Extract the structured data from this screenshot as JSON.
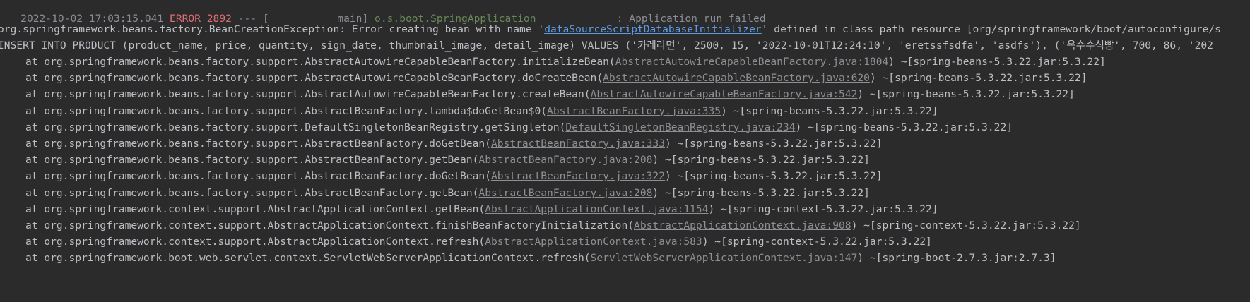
{
  "console": {
    "top_line": {
      "timestamp": "2022-10-02 17:03:15.041",
      "level": "ERROR 2892",
      "separator": "---",
      "thread": "[           main]",
      "logger": "o.s.boot.SpringApplication",
      "message": ": Application run failed"
    },
    "exception": {
      "prefix": "org.springframework.beans.factory.BeanCreationException: Error creating bean with name '",
      "bean_link": "dataSourceScriptDatabaseInitializer",
      "suffix": "' defined in class path resource [org/springframework/boot/autoconfigure/s"
    },
    "sql_line": "INSERT INTO PRODUCT (product_name, price, quantity, sign_date, thumbnail_image, detail_image) VALUES ('카레라면', 2500, 15, '2022-10-01T12:24:10', 'eretssfsdfa', 'asdfs'), ('옥수수식빵', 700, 86, '202",
    "stack": [
      {
        "method": "at org.springframework.beans.factory.support.AbstractAutowireCapableBeanFactory.initializeBean(",
        "source": "AbstractAutowireCapableBeanFactory.java:1804",
        "jar": ") ~[spring-beans-5.3.22.jar:5.3.22]"
      },
      {
        "method": "at org.springframework.beans.factory.support.AbstractAutowireCapableBeanFactory.doCreateBean(",
        "source": "AbstractAutowireCapableBeanFactory.java:620",
        "jar": ") ~[spring-beans-5.3.22.jar:5.3.22]"
      },
      {
        "method": "at org.springframework.beans.factory.support.AbstractAutowireCapableBeanFactory.createBean(",
        "source": "AbstractAutowireCapableBeanFactory.java:542",
        "jar": ") ~[spring-beans-5.3.22.jar:5.3.22]"
      },
      {
        "method": "at org.springframework.beans.factory.support.AbstractBeanFactory.lambda$doGetBean$0(",
        "source": "AbstractBeanFactory.java:335",
        "jar": ") ~[spring-beans-5.3.22.jar:5.3.22]"
      },
      {
        "method": "at org.springframework.beans.factory.support.DefaultSingletonBeanRegistry.getSingleton(",
        "source": "DefaultSingletonBeanRegistry.java:234",
        "jar": ") ~[spring-beans-5.3.22.jar:5.3.22]"
      },
      {
        "method": "at org.springframework.beans.factory.support.AbstractBeanFactory.doGetBean(",
        "source": "AbstractBeanFactory.java:333",
        "jar": ") ~[spring-beans-5.3.22.jar:5.3.22]"
      },
      {
        "method": "at org.springframework.beans.factory.support.AbstractBeanFactory.getBean(",
        "source": "AbstractBeanFactory.java:208",
        "jar": ") ~[spring-beans-5.3.22.jar:5.3.22]"
      },
      {
        "method": "at org.springframework.beans.factory.support.AbstractBeanFactory.doGetBean(",
        "source": "AbstractBeanFactory.java:322",
        "jar": ") ~[spring-beans-5.3.22.jar:5.3.22]"
      },
      {
        "method": "at org.springframework.beans.factory.support.AbstractBeanFactory.getBean(",
        "source": "AbstractBeanFactory.java:208",
        "jar": ") ~[spring-beans-5.3.22.jar:5.3.22]"
      },
      {
        "method": "at org.springframework.context.support.AbstractApplicationContext.getBean(",
        "source": "AbstractApplicationContext.java:1154",
        "jar": ") ~[spring-context-5.3.22.jar:5.3.22]"
      },
      {
        "method": "at org.springframework.context.support.AbstractApplicationContext.finishBeanFactoryInitialization(",
        "source": "AbstractApplicationContext.java:908",
        "jar": ") ~[spring-context-5.3.22.jar:5.3.22]"
      },
      {
        "method": "at org.springframework.context.support.AbstractApplicationContext.refresh(",
        "source": "AbstractApplicationContext.java:583",
        "jar": ") ~[spring-context-5.3.22.jar:5.3.22]"
      },
      {
        "method": "at org.springframework.boot.web.servlet.context.ServletWebServerApplicationContext.refresh(",
        "source": "ServletWebServerApplicationContext.java:147",
        "jar": ") ~[spring-boot-2.7.3.jar:2.7.3]"
      }
    ]
  }
}
